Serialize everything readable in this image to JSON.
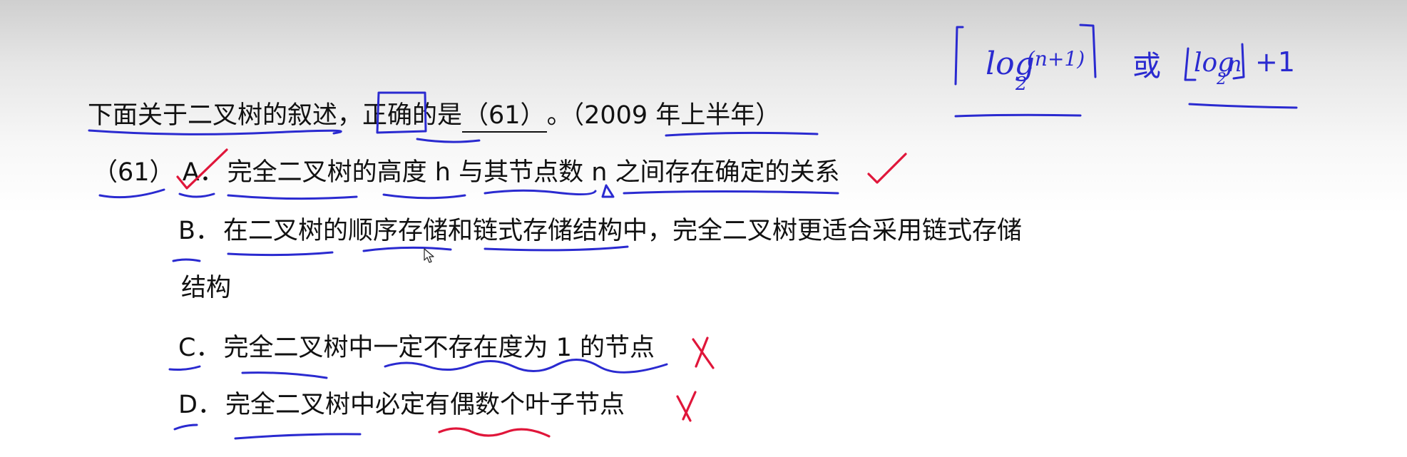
{
  "question": {
    "stem": "下面关于二叉树的叙述，正确的是",
    "blank": "（61）",
    "tail": "。（2009 年上半年）"
  },
  "options": {
    "number": "（61）",
    "a": {
      "letter": "A．",
      "text": "完全二叉树的高度 h 与其节点数 n 之间存在确定的关系"
    },
    "b": {
      "letter": "B．",
      "text": "在二叉树的顺序存储和链式存储结构中，完全二叉树更适合采用链式存储",
      "continuation": "结构"
    },
    "c": {
      "letter": "C．",
      "text": "完全二叉树中一定不存在度为 1 的节点"
    },
    "d": {
      "letter": "D．",
      "text": "完全二叉树中必定有偶数个叶子节点"
    }
  },
  "annotations": {
    "ink_blue": "#2a2ad0",
    "ink_red": "#e0163a",
    "correct_mark": "check-mark-icon",
    "wrong_mark": "cross-mark-icon",
    "formula_1": {
      "log_text": "log",
      "subscript": "2",
      "argument": "(n+1)"
    },
    "formula_connector": "或",
    "formula_2": {
      "log_text": "log",
      "subscript": "2",
      "argument": "n",
      "suffix": "+1"
    }
  }
}
